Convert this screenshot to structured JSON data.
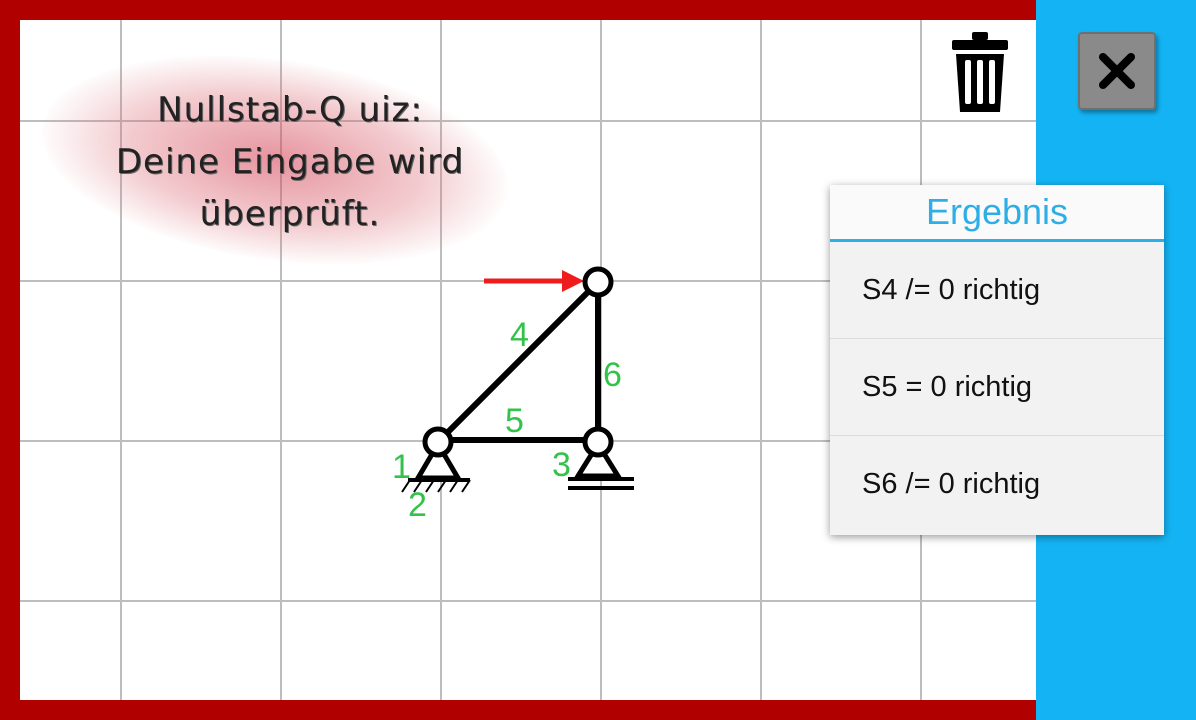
{
  "quiz": {
    "line1": "Nullstab-Q uiz:",
    "line2": "Deine Eingabe wird",
    "line3": "überprüft."
  },
  "truss": {
    "member_labels": [
      "4",
      "5",
      "6"
    ],
    "node_labels": [
      "1",
      "2",
      "3"
    ],
    "force_color": "#ee1c1c",
    "label_color": "#33c24a"
  },
  "toolbar": {
    "trash_icon": "trash-icon",
    "close_icon": "close-icon"
  },
  "result": {
    "title": "Ergebnis",
    "items": [
      "S4 /= 0 richtig",
      "S5 = 0 richtig",
      "S6 /= 0 richtig"
    ]
  },
  "colors": {
    "frame": "#b00000",
    "sidebar": "#14b4f4",
    "accent": "#2eaee6"
  }
}
